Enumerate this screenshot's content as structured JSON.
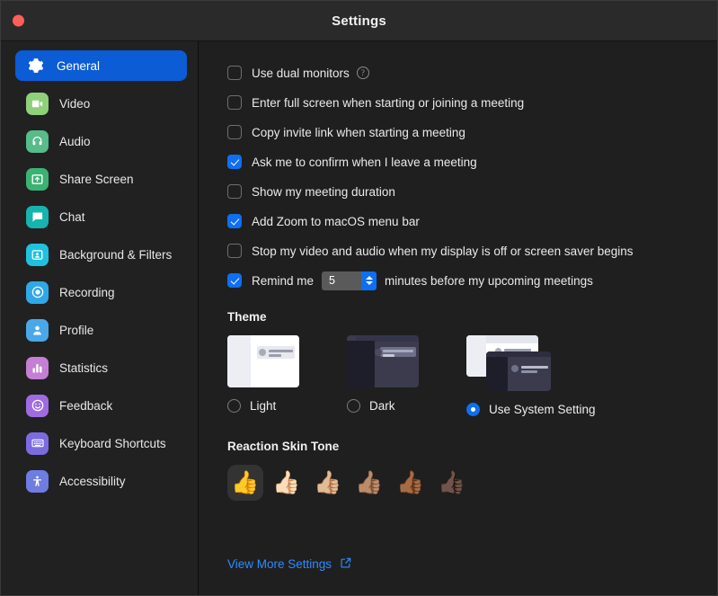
{
  "window": {
    "title": "Settings",
    "close_button": "close",
    "accent_color": "#0e6ff0",
    "link_color": "#2d8cff"
  },
  "sidebar": {
    "items": [
      {
        "label": "General",
        "icon": "gear-icon",
        "icon_color": "#0b5cd5",
        "active": true
      },
      {
        "label": "Video",
        "icon": "video-camera-icon",
        "icon_color": "#8fd07a",
        "active": false
      },
      {
        "label": "Audio",
        "icon": "headphones-icon",
        "icon_color": "#57bb8a",
        "active": false
      },
      {
        "label": "Share Screen",
        "icon": "share-screen-icon",
        "icon_color": "#3bb273",
        "active": false
      },
      {
        "label": "Chat",
        "icon": "chat-bubble-icon",
        "icon_color": "#17b3ae",
        "active": false
      },
      {
        "label": "Background & Filters",
        "icon": "background-filter-icon",
        "icon_color": "#1fc1df",
        "active": false
      },
      {
        "label": "Recording",
        "icon": "record-circle-icon",
        "icon_color": "#30a8e8",
        "active": false
      },
      {
        "label": "Profile",
        "icon": "person-icon",
        "icon_color": "#4aa8e8",
        "active": false
      },
      {
        "label": "Statistics",
        "icon": "bar-chart-icon",
        "icon_color": "#c47fd4",
        "active": false
      },
      {
        "label": "Feedback",
        "icon": "smiley-face-icon",
        "icon_color": "#a06be0",
        "active": false
      },
      {
        "label": "Keyboard Shortcuts",
        "icon": "keyboard-icon",
        "icon_color": "#7c6be0",
        "active": false
      },
      {
        "label": "Accessibility",
        "icon": "accessibility-icon",
        "icon_color": "#6f7de2",
        "active": false
      }
    ]
  },
  "main": {
    "checkboxes": [
      {
        "label": "Use dual monitors",
        "checked": false,
        "help": "?"
      },
      {
        "label": "Enter full screen when starting or joining a meeting",
        "checked": false
      },
      {
        "label": "Copy invite link when starting a meeting",
        "checked": false
      },
      {
        "label": "Ask me to confirm when I leave a meeting",
        "checked": true
      },
      {
        "label": "Show my meeting duration",
        "checked": false
      },
      {
        "label": "Add Zoom to macOS menu bar",
        "checked": true
      },
      {
        "label": "Stop my video and audio when my display is off or screen saver begins",
        "checked": false
      }
    ],
    "remind": {
      "checked": true,
      "label_before": "Remind me",
      "minutes_value": "5",
      "label_after": "minutes before my upcoming meetings"
    },
    "theme": {
      "heading": "Theme",
      "options": [
        {
          "label": "Light",
          "selected": false,
          "preview": "light-window-preview"
        },
        {
          "label": "Dark",
          "selected": false,
          "preview": "dark-window-preview"
        },
        {
          "label": "Use System Setting",
          "selected": true,
          "preview": "system-window-preview"
        }
      ]
    },
    "skin_tone": {
      "heading": "Reaction Skin Tone",
      "options": [
        {
          "name": "thumbs-up-default",
          "glyph": "👍",
          "selected": true
        },
        {
          "name": "thumbs-up-light",
          "glyph": "👍🏻",
          "selected": false
        },
        {
          "name": "thumbs-up-medium-light",
          "glyph": "👍🏼",
          "selected": false
        },
        {
          "name": "thumbs-up-medium",
          "glyph": "👍🏽",
          "selected": false
        },
        {
          "name": "thumbs-up-medium-dark",
          "glyph": "👍🏾",
          "selected": false
        },
        {
          "name": "thumbs-up-dark",
          "glyph": "👍🏿",
          "selected": false
        }
      ]
    },
    "more_settings_link": "View More Settings"
  }
}
